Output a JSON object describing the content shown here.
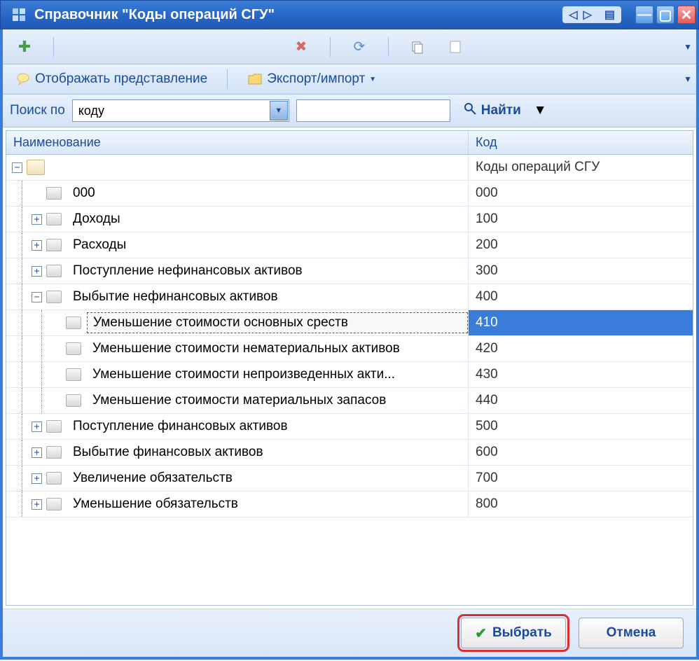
{
  "window": {
    "title": "Справочник \"Коды операций СГУ\""
  },
  "toolbar": {
    "display_view": "Отображать представление",
    "export_import": "Экспорт/импорт"
  },
  "search": {
    "label": "Поиск по",
    "mode": "коду",
    "value": "",
    "find": "Найти"
  },
  "grid": {
    "headers": {
      "name": "Наименование",
      "code": "Код"
    },
    "root": {
      "name": "",
      "code": "Коды операций СГУ"
    },
    "rows": [
      {
        "level": 1,
        "expand": "none",
        "name": "000",
        "code": "000",
        "selected": false
      },
      {
        "level": 1,
        "expand": "plus",
        "name": "Доходы",
        "code": "100",
        "selected": false
      },
      {
        "level": 1,
        "expand": "plus",
        "name": "Расходы",
        "code": "200",
        "selected": false
      },
      {
        "level": 1,
        "expand": "plus",
        "name": "Поступление нефинансовых активов",
        "code": "300",
        "selected": false
      },
      {
        "level": 1,
        "expand": "minus",
        "name": "Выбытие нефинансовых активов",
        "code": "400",
        "selected": false
      },
      {
        "level": 2,
        "expand": "none",
        "name": "Уменьшение стоимости основных среств",
        "code": "410",
        "selected": true
      },
      {
        "level": 2,
        "expand": "none",
        "name": "Уменьшение стоимости нематериальных активов",
        "code": "420",
        "selected": false
      },
      {
        "level": 2,
        "expand": "none",
        "name": "Уменьшение стоимости непроизведенных акти...",
        "code": "430",
        "selected": false
      },
      {
        "level": 2,
        "expand": "none",
        "name": "Уменьшение стоимости материальных запасов",
        "code": "440",
        "selected": false
      },
      {
        "level": 1,
        "expand": "plus",
        "name": "Поступление финансовых активов",
        "code": "500",
        "selected": false
      },
      {
        "level": 1,
        "expand": "plus",
        "name": "Выбытие финансовых активов",
        "code": "600",
        "selected": false
      },
      {
        "level": 1,
        "expand": "plus",
        "name": "Увеличение обязательств",
        "code": "700",
        "selected": false
      },
      {
        "level": 1,
        "expand": "plus",
        "name": "Уменьшение обязательств",
        "code": "800",
        "selected": false
      }
    ]
  },
  "footer": {
    "select": "Выбрать",
    "cancel": "Отмена"
  }
}
